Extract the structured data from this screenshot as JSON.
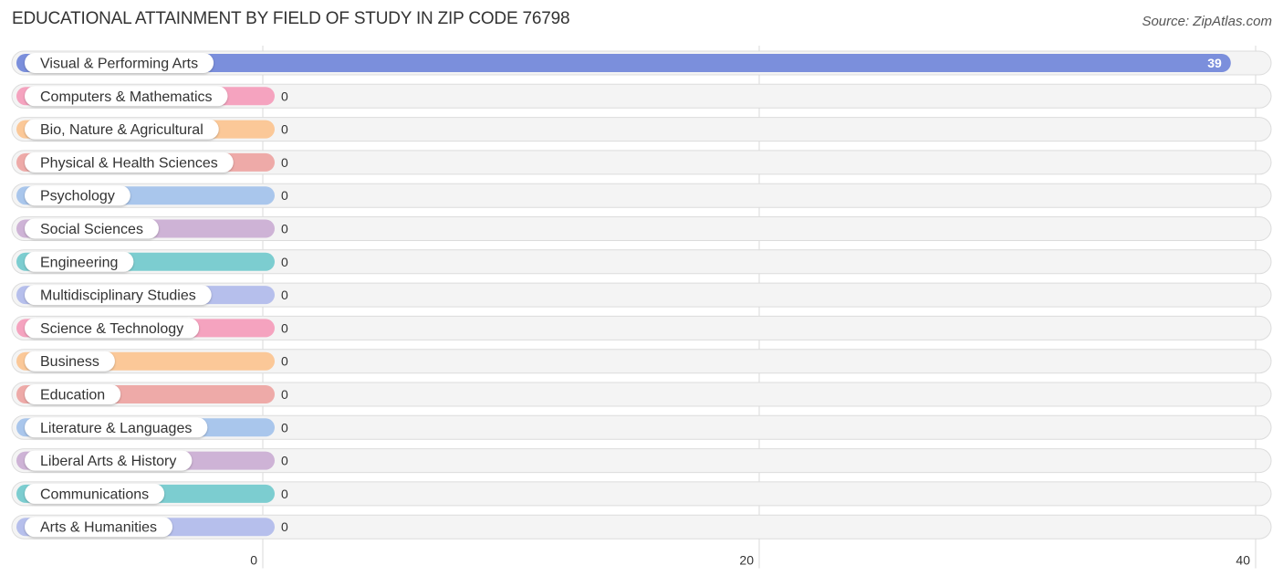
{
  "header": {
    "title": "EDUCATIONAL ATTAINMENT BY FIELD OF STUDY IN ZIP CODE 76798",
    "source": "Source: ZipAtlas.com"
  },
  "chart_data": {
    "type": "bar",
    "orientation": "horizontal",
    "title": "EDUCATIONAL ATTAINMENT BY FIELD OF STUDY IN ZIP CODE 76798",
    "xlabel": "",
    "ylabel": "",
    "xlim": [
      0,
      40
    ],
    "xticks": [
      0,
      20,
      40
    ],
    "grid": true,
    "categories": [
      "Visual & Performing Arts",
      "Computers & Mathematics",
      "Bio, Nature & Agricultural",
      "Physical & Health Sciences",
      "Psychology",
      "Social Sciences",
      "Engineering",
      "Multidisciplinary Studies",
      "Science & Technology",
      "Business",
      "Education",
      "Literature & Languages",
      "Liberal Arts & History",
      "Communications",
      "Arts & Humanities"
    ],
    "values": [
      39,
      0,
      0,
      0,
      0,
      0,
      0,
      0,
      0,
      0,
      0,
      0,
      0,
      0,
      0
    ],
    "colors": [
      "#7b8fdc",
      "#f5a3bf",
      "#fbc898",
      "#eeaaa8",
      "#a9c6ec",
      "#ceb3d6",
      "#7ccdd0",
      "#b6bfec",
      "#f5a3bf",
      "#fbc898",
      "#eeaaa8",
      "#a9c6ec",
      "#ceb3d6",
      "#7ccdd0",
      "#b6bfec"
    ]
  }
}
